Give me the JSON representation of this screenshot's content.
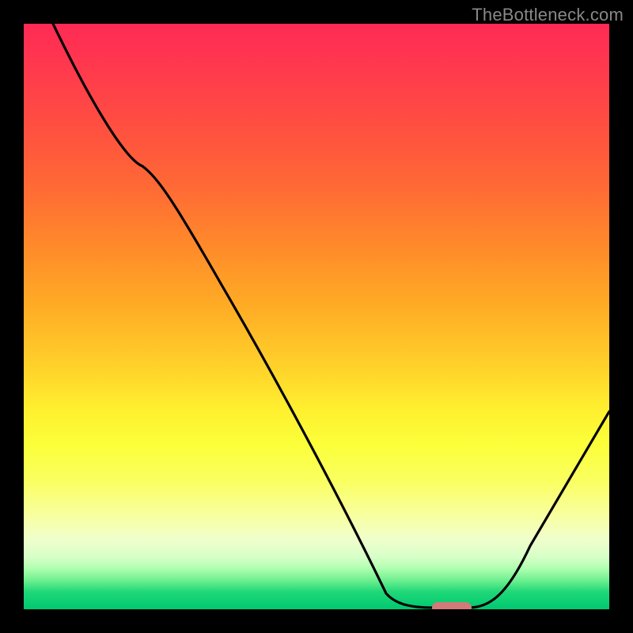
{
  "watermark": "TheBottleneck.com",
  "chart_data": {
    "type": "line",
    "title": "",
    "xlabel": "",
    "ylabel": "",
    "xlim": [
      0,
      100
    ],
    "ylim": [
      0,
      100
    ],
    "grid": false,
    "series": [
      {
        "name": "curve",
        "x": [
          5,
          20,
          25,
          62,
          70,
          76,
          100
        ],
        "values": [
          100,
          76,
          70,
          2,
          0,
          0,
          34
        ]
      }
    ],
    "marker": {
      "x_start": 70,
      "x_end": 76,
      "y": 0,
      "color": "#d27a7a"
    },
    "gradient_stops": [
      {
        "pct": 0,
        "color": "#ff2a55"
      },
      {
        "pct": 50,
        "color": "#ffab25"
      },
      {
        "pct": 75,
        "color": "#fbff3a"
      },
      {
        "pct": 100,
        "color": "#00c870"
      }
    ]
  }
}
